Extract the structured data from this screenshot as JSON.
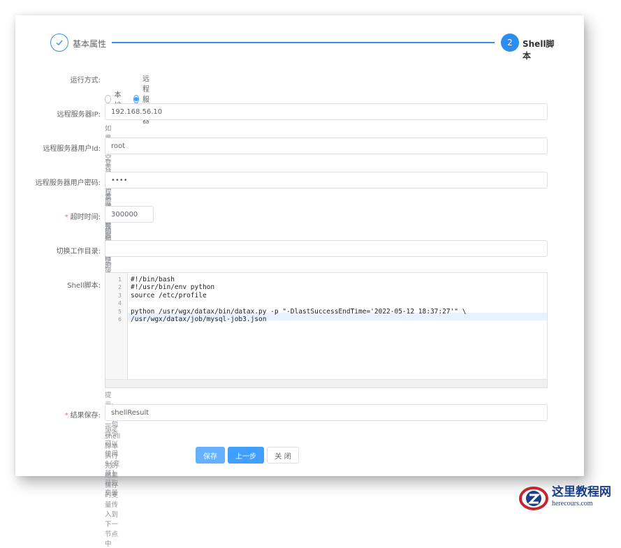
{
  "steps": {
    "step1": {
      "label": "基本属性"
    },
    "step2": {
      "number": "2",
      "label": "Shell脚本"
    }
  },
  "form": {
    "run_mode": {
      "label": "运行方式:",
      "options": [
        {
          "label": "本地",
          "checked": false
        },
        {
          "label": "远程服务器",
          "checked": true
        }
      ]
    },
    "remote_ip": {
      "label": "远程服务器IP:",
      "value": "192.168.56.10",
      "hint": "如果为空表示在本地服务器执行"
    },
    "remote_user": {
      "label": "远程服务器用户Id:",
      "value": "root",
      "hint": "登录远程服务器的用户Id"
    },
    "remote_password": {
      "label": "远程服务器用户密码:",
      "value": "••••",
      "hint": "登录远程服务器的用户密码"
    },
    "timeout": {
      "label": "超时时间:",
      "required_mark": "*",
      "value": "300000",
      "hint": "执行和链接超时时间毫秒"
    },
    "work_dir": {
      "label": "切换工作目录:",
      "value": "",
      "hint": "空表示不切换"
    },
    "shell_script": {
      "label": "Shell脚本:",
      "line_numbers": [
        "1",
        "2",
        "3",
        "4",
        "5",
        "6"
      ],
      "lines": [
        "#!/bin/bash",
        "#!/usr/bin/env python",
        "source /etc/profile",
        "",
        "python /usr/wgx/datax/bin/datax.py -p \"-DlastSuccessEndTime='2022-05-12 18:37:27'\" \\",
        "/usr/wgx/datax/job/mysql-job3.json"
      ],
      "hint": "提示:每行一句命令可以使用${变量}获取变量"
    },
    "result_save": {
      "label": "结果保存:",
      "required_mark": "*",
      "value": "shellResult",
      "hint": "指定shell脚本执行完的结果保存的变量传入到下一节点中"
    }
  },
  "buttons": {
    "save": "保存",
    "prev": "上一步",
    "close": "关 闭"
  },
  "watermark": {
    "title": "这里教程网",
    "url": "herecours.com"
  },
  "colors": {
    "primary": "#409eff",
    "primary_light": "#66b1ff",
    "required": "#f56c6c",
    "watermark": "#1a3e8c"
  }
}
